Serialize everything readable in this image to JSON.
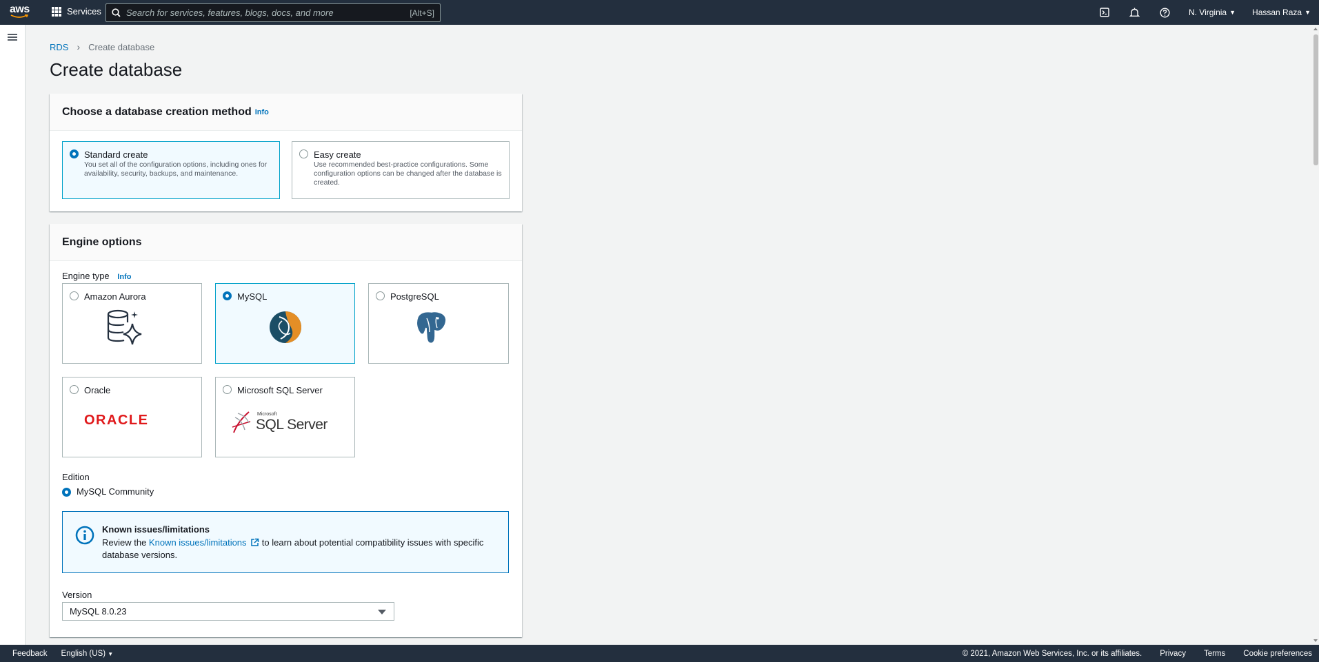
{
  "topbar": {
    "logo_text": "aws",
    "services_label": "Services",
    "search_placeholder": "Search for services, features, blogs, docs, and more",
    "search_shortcut": "[Alt+S]",
    "region": "N. Virginia",
    "user": "Hassan Raza",
    "icons": [
      "cloudshell-icon",
      "bell-icon",
      "help-icon"
    ]
  },
  "breadcrumb": {
    "root": "RDS",
    "current": "Create database"
  },
  "page_title": "Create database",
  "creation_method": {
    "title": "Choose a database creation method",
    "info": "Info",
    "options": [
      {
        "title": "Standard create",
        "desc": "You set all of the configuration options, including ones for availability, security, backups, and maintenance.",
        "selected": true
      },
      {
        "title": "Easy create",
        "desc": "Use recommended best-practice configurations. Some configuration options can be changed after the database is created.",
        "selected": false
      }
    ]
  },
  "engine_options": {
    "title": "Engine options",
    "engine_type_label": "Engine type",
    "info": "Info",
    "engines": [
      {
        "title": "Amazon Aurora",
        "selected": false,
        "icon": "aurora-icon"
      },
      {
        "title": "MySQL",
        "selected": true,
        "icon": "mysql-icon"
      },
      {
        "title": "PostgreSQL",
        "selected": false,
        "icon": "postgresql-icon"
      },
      {
        "title": "Oracle",
        "selected": false,
        "logo_text": "ORACLE"
      },
      {
        "title": "Microsoft SQL Server",
        "selected": false,
        "logo_small": "Microsoft",
        "logo_text": "SQL Server"
      }
    ],
    "edition_label": "Edition",
    "edition_value": "MySQL Community",
    "alert": {
      "title": "Known issues/limitations",
      "body_before": "Review the ",
      "link": "Known issues/limitations",
      "body_after": " to learn about potential compatibility issues with specific database versions."
    },
    "version_label": "Version",
    "version_value": "MySQL 8.0.23"
  },
  "footer": {
    "feedback": "Feedback",
    "language": "English (US)",
    "copyright": "© 2021, Amazon Web Services, Inc. or its affiliates.",
    "privacy": "Privacy",
    "terms": "Terms",
    "cookies": "Cookie preferences"
  },
  "colors": {
    "topbar": "#232f3e",
    "link": "#0073bb",
    "selected_border": "#00a1c9",
    "selected_bg": "#f1faff"
  }
}
